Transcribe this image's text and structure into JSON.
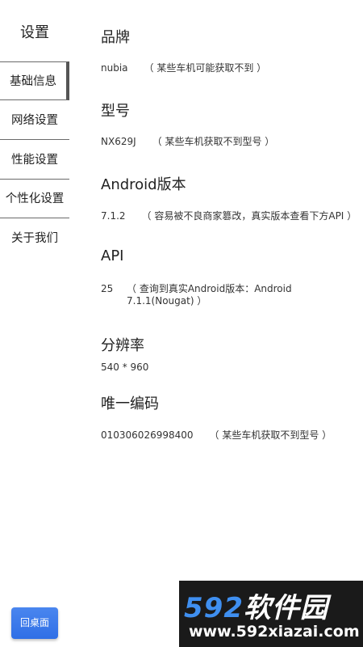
{
  "sidebar": {
    "title": "设置",
    "items": [
      {
        "label": "基础信息"
      },
      {
        "label": "网络设置"
      },
      {
        "label": "性能设置"
      },
      {
        "label": "个性化设置"
      },
      {
        "label": "关于我们"
      }
    ]
  },
  "sections": {
    "brand": {
      "title": "品牌",
      "value": "nubia",
      "note": "（ 某些车机可能获取不到 ）"
    },
    "model": {
      "title": "型号",
      "value": "NX629J",
      "note": "（ 某些车机获取不到型号 ）"
    },
    "android": {
      "title": "Android版本",
      "value": "7.1.2",
      "note": "（ 容易被不良商家篡改，真实版本查看下方API ）"
    },
    "api": {
      "title": "API",
      "value": "25",
      "note_line1": "（ 查询到真实Android版本：Android",
      "note_line2": "7.1.1(Nougat) ）"
    },
    "resolution": {
      "title": "分辨率",
      "value": "540 * 960"
    },
    "unique_code": {
      "title": "唯一编码",
      "value": "010306026998400",
      "note": "（ 某些车机获取不到型号 ）"
    }
  },
  "home_button": {
    "label": "回桌面"
  },
  "watermark": {
    "brand_num": "592",
    "brand_text": "软件园",
    "url": "www.592xiazai.com"
  },
  "colors": {
    "accent": "#2f6fe6",
    "watermark_bg": "#1a1a1a",
    "watermark_blue": "#3f8ff0"
  }
}
